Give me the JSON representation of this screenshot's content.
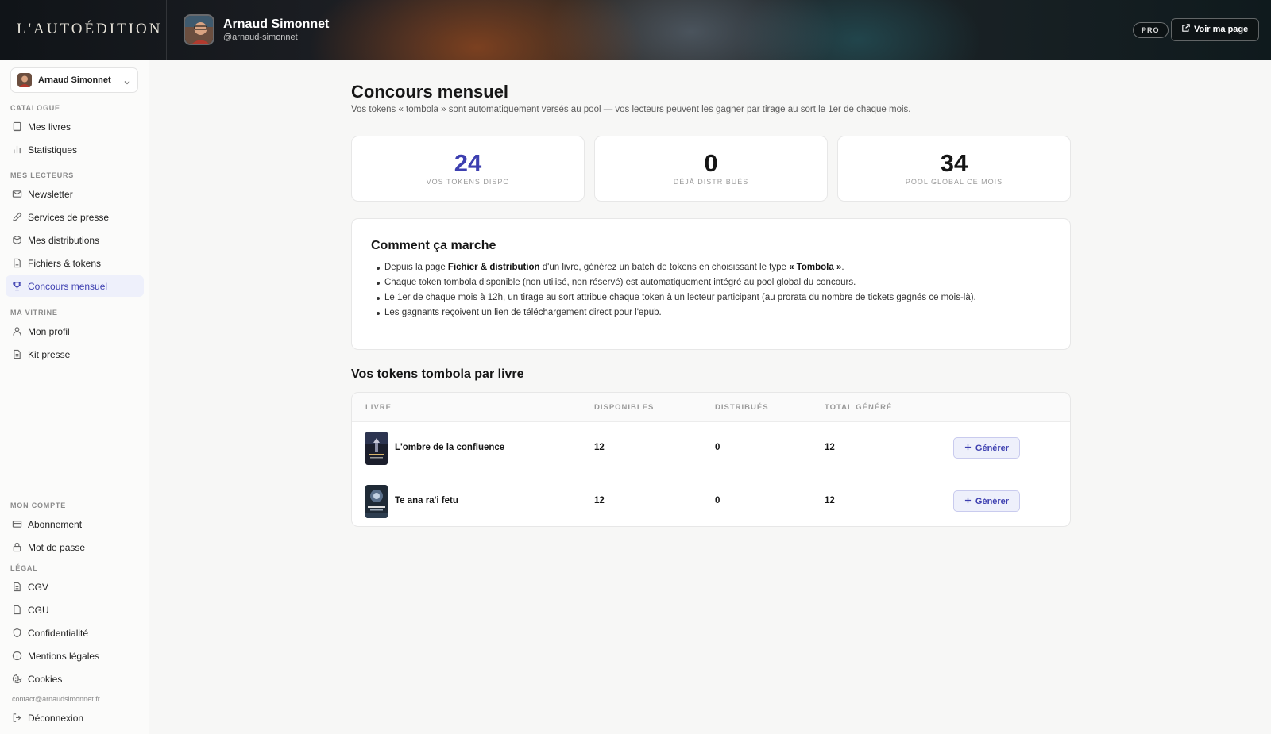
{
  "header": {
    "brand": "L'AUTOÉDITION",
    "author_name": "Arnaud Simonnet",
    "author_handle": "@arnaud-simonnet",
    "plan_badge": "PRO",
    "view_page_label": "Voir ma page"
  },
  "sidebar": {
    "account_name": "Arnaud Simonnet",
    "sections": {
      "catalogue": "CATALOGUE",
      "lecteurs": "MES LECTEURS",
      "vitrine": "MA VITRINE",
      "compte": "MON COMPTE",
      "legal": "LÉGAL"
    },
    "items": {
      "livres": "Mes livres",
      "statistiques": "Statistiques",
      "newsletter": "Newsletter",
      "presse": "Services de presse",
      "distributions": "Mes distributions",
      "fichiers": "Fichiers & tokens",
      "concours": "Concours mensuel",
      "profil": "Mon profil",
      "kit": "Kit presse",
      "abonnement": "Abonnement",
      "motdepasse": "Mot de passe",
      "cgv": "CGV",
      "cgu": "CGU",
      "confidentialite": "Confidentialité",
      "mentions": "Mentions légales",
      "cookies": "Cookies",
      "deconnexion": "Déconnexion"
    },
    "email": "contact@arnaudsimonnet.fr",
    "active_item": "Concours mensuel"
  },
  "page": {
    "title": "Concours mensuel",
    "subtitle": "Vos tokens « tombola » sont automatiquement versés au pool — vos lecteurs peuvent les gagner par tirage au sort le 1er de chaque mois."
  },
  "stats": [
    {
      "value": "24",
      "label": "VOS TOKENS DISPO"
    },
    {
      "value": "0",
      "label": "DÉJÀ DISTRIBUÉS"
    },
    {
      "value": "34",
      "label": "POOL GLOBAL CE MOIS"
    }
  ],
  "how": {
    "title": "Comment ça marche",
    "items": {
      "b1_pre": "Depuis la page ",
      "b1_bold1": "Fichier & distribution",
      "b1_mid": " d'un livre, générez un batch de tokens en choisissant le type ",
      "b1_bold2": "« Tombola »",
      "b1_post": ".",
      "b2": "Chaque token tombola disponible (non utilisé, non réservé) est automatiquement intégré au pool global du concours.",
      "b3": "Le 1er de chaque mois à 12h, un tirage au sort attribue chaque token à un lecteur participant (au prorata du nombre de tickets gagnés ce mois-là).",
      "b4": "Les gagnants reçoivent un lien de téléchargement direct pour l'epub."
    }
  },
  "tokens_table": {
    "title": "Vos tokens tombola par livre",
    "columns": {
      "livre": "LIVRE",
      "disponibles": "DISPONIBLES",
      "distribues": "DISTRIBUÉS",
      "total": "TOTAL GÉNÉRÉ"
    },
    "rows": [
      {
        "title": "L'ombre de la confluence",
        "disponibles": "12",
        "distribues": "0",
        "total": "12",
        "action": "Générer"
      },
      {
        "title": "Te ana ra'i fetu",
        "disponibles": "12",
        "distribues": "0",
        "total": "12",
        "action": "Générer"
      }
    ]
  },
  "colors": {
    "accent": "#3d3fb0",
    "active_bg": "#eef0fb"
  }
}
